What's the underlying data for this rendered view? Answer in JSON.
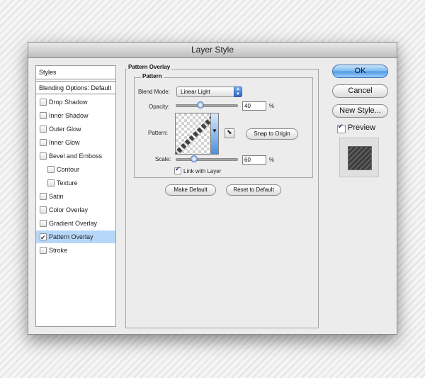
{
  "window": {
    "title": "Layer Style"
  },
  "styles_list": {
    "header": "Styles",
    "blending_options": "Blending Options: Default",
    "items": [
      {
        "label": "Drop Shadow",
        "checked": false,
        "indent": false,
        "selected": false
      },
      {
        "label": "Inner Shadow",
        "checked": false,
        "indent": false,
        "selected": false
      },
      {
        "label": "Outer Glow",
        "checked": false,
        "indent": false,
        "selected": false
      },
      {
        "label": "Inner Glow",
        "checked": false,
        "indent": false,
        "selected": false
      },
      {
        "label": "Bevel and Emboss",
        "checked": false,
        "indent": false,
        "selected": false
      },
      {
        "label": "Contour",
        "checked": false,
        "indent": true,
        "selected": false
      },
      {
        "label": "Texture",
        "checked": false,
        "indent": true,
        "selected": false
      },
      {
        "label": "Satin",
        "checked": false,
        "indent": false,
        "selected": false
      },
      {
        "label": "Color Overlay",
        "checked": false,
        "indent": false,
        "selected": false
      },
      {
        "label": "Gradient Overlay",
        "checked": false,
        "indent": false,
        "selected": false
      },
      {
        "label": "Pattern Overlay",
        "checked": true,
        "indent": false,
        "selected": true
      },
      {
        "label": "Stroke",
        "checked": false,
        "indent": false,
        "selected": false
      }
    ]
  },
  "pattern_overlay": {
    "section_title": "Pattern Overlay",
    "group_title": "Pattern",
    "blend_mode_label": "Blend Mode:",
    "blend_mode_value": "Linear Light",
    "opacity_label": "Opacity:",
    "opacity_value": "40",
    "opacity_unit": "%",
    "pattern_label": "Pattern:",
    "snap_to_origin": "Snap to Origin",
    "scale_label": "Scale:",
    "scale_value": "60",
    "scale_unit": "%",
    "link_with_layer": "Link with Layer",
    "link_with_layer_checked": true,
    "make_default": "Make Default",
    "reset_to_default": "Reset to Default"
  },
  "buttons": {
    "ok": "OK",
    "cancel": "Cancel",
    "new_style": "New Style...",
    "preview_label": "Preview",
    "preview_checked": true
  },
  "colors": {
    "selection": "#b6d7f7",
    "accent": "#4d98e6"
  }
}
